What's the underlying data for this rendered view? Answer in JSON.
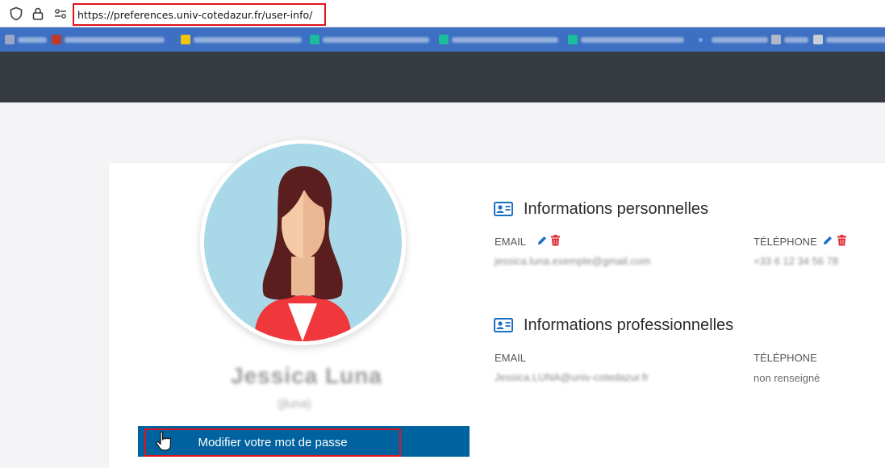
{
  "browser": {
    "url": "https://preferences.univ-cotedazur.fr/user-info/"
  },
  "bookmarks": [
    {
      "favicon_color": "#9aa7c4"
    },
    {
      "favicon_color": "#c0392b"
    },
    {
      "favicon_color": "#f1c40f"
    },
    {
      "favicon_color": "#1abc9c"
    },
    {
      "favicon_color": "#1abc9c"
    },
    {
      "favicon_color": "#1abc9c"
    },
    {
      "favicon_color": "#5dade2"
    },
    {
      "favicon_color": "#b0b8c8"
    },
    {
      "favicon_color": "#c8cdd6"
    }
  ],
  "profile": {
    "full_name": "Jessica Luna",
    "username": "(jluna)",
    "change_password_label": "Modifier votre mot de passe"
  },
  "personal": {
    "title": "Informations personnelles",
    "email_label": "EMAIL",
    "email_value": "jessica.luna.exemple@gmail.com",
    "phone_label": "TÉLÉPHONE",
    "phone_value": "+33 6 12 34 56 78"
  },
  "professional": {
    "title": "Informations professionnelles",
    "email_label": "EMAIL",
    "email_value": "Jessica.LUNA@univ-cotedazur.fr",
    "phone_label": "TÉLÉPHONE",
    "phone_value": "non renseigné"
  },
  "colors": {
    "accent": "#00629e",
    "highlight": "#e0141b",
    "header": "#363a41",
    "edit_icon": "#1d6fc4",
    "delete_icon": "#e0262f"
  }
}
